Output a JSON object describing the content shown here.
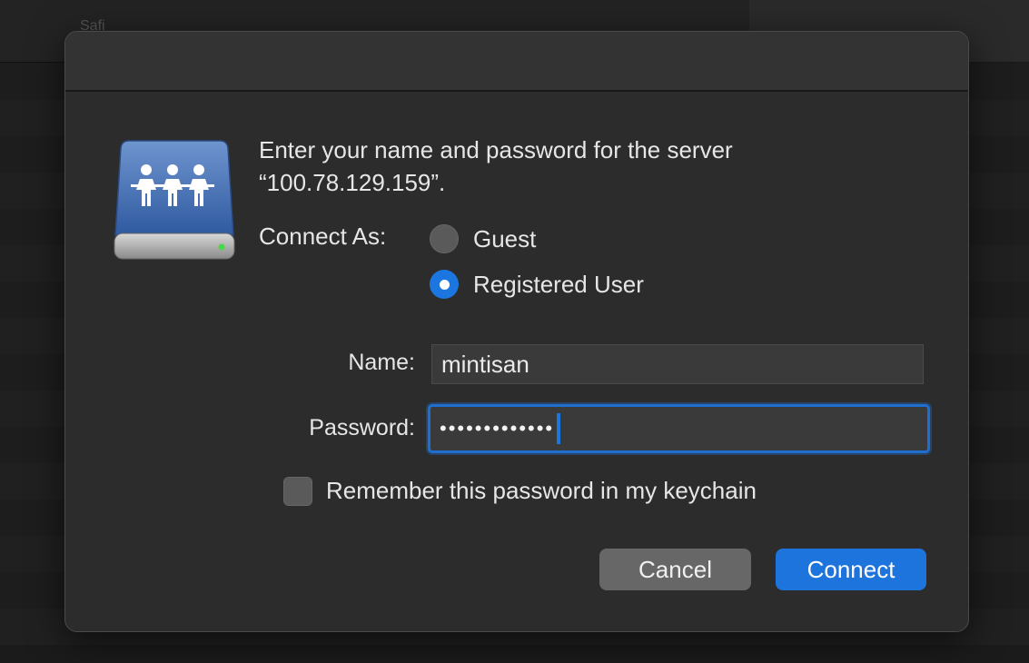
{
  "background": {
    "window_title": "Safi"
  },
  "dialog": {
    "icon": "network-server-icon",
    "prompt_line1": "Enter your name and password for the server",
    "prompt_line2": "“100.78.129.159”.",
    "connect_as_label": "Connect As:",
    "options": [
      {
        "label": "Guest",
        "selected": false
      },
      {
        "label": "Registered User",
        "selected": true
      }
    ],
    "name_label": "Name:",
    "name_value": "mintisan",
    "password_label": "Password:",
    "password_value": "•••••••••••••",
    "remember_label": "Remember this password in my keychain",
    "remember_checked": false,
    "cancel_label": "Cancel",
    "connect_label": "Connect"
  },
  "colors": {
    "accent": "#1d74dc",
    "dialog_bg": "#2c2c2c"
  }
}
